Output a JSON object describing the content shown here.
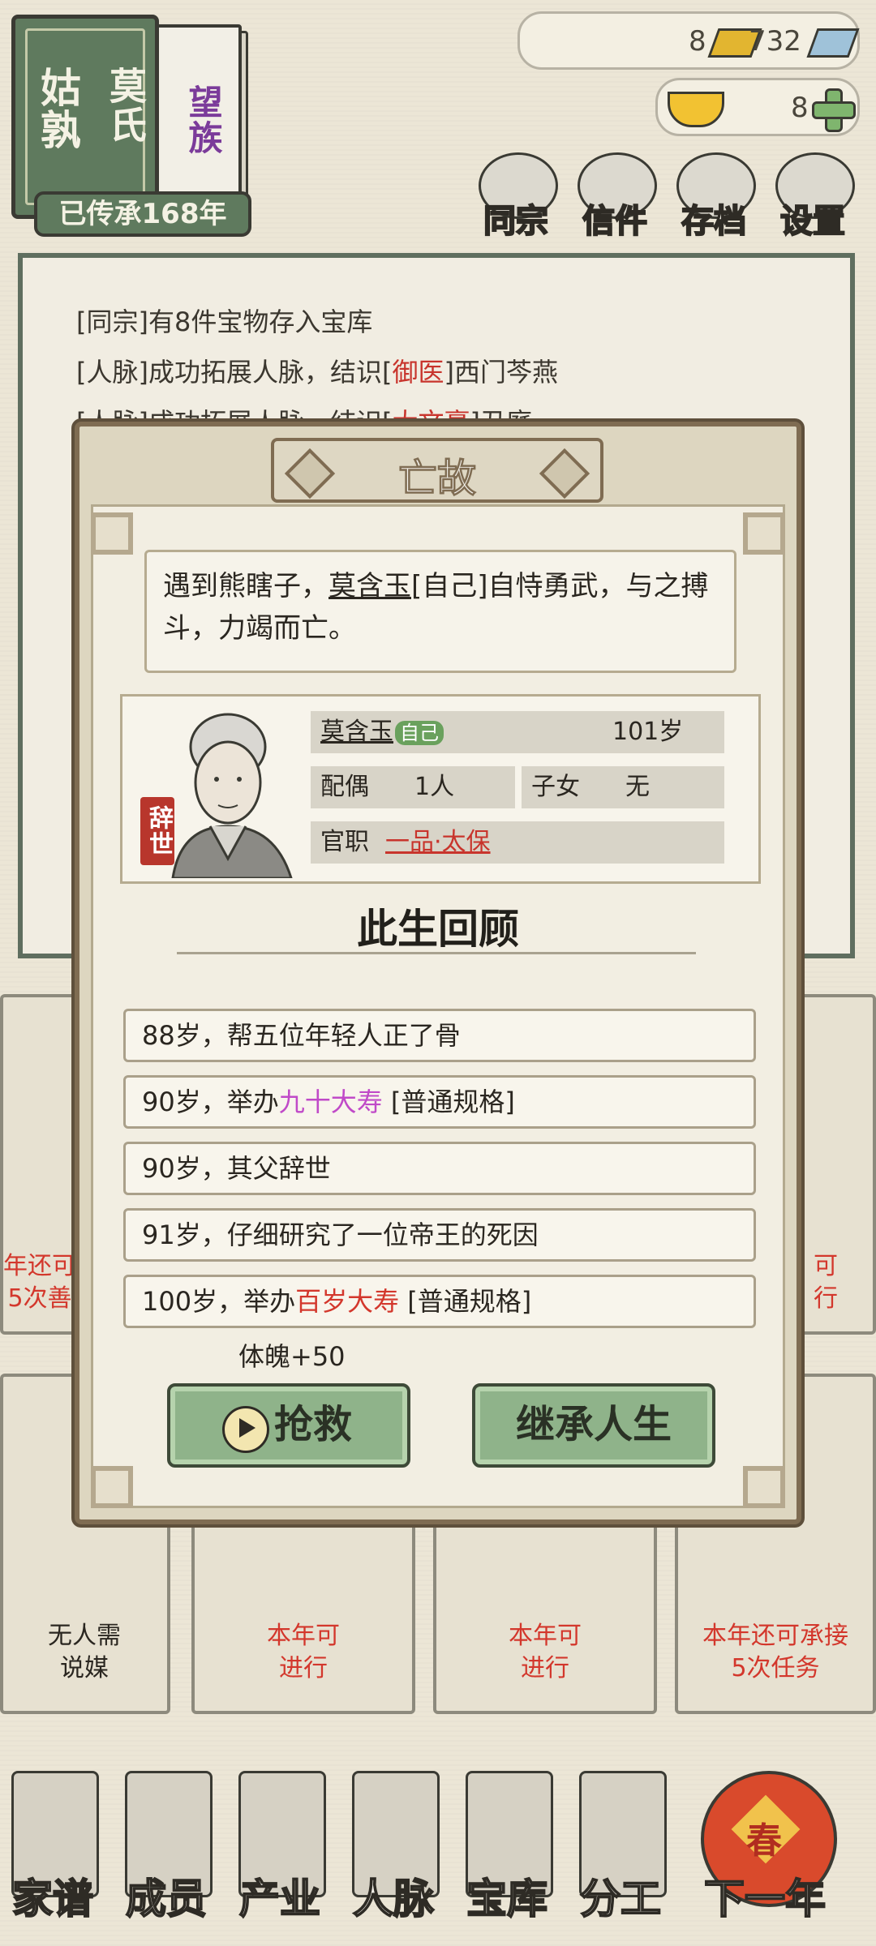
{
  "clan": {
    "surname": "姑孰",
    "name": "莫氏",
    "tag": "望族",
    "inherited": "已传承168年"
  },
  "currency": {
    "bars_count": "8",
    "silver_count": "732",
    "ingot_count": "8"
  },
  "top_menu": [
    "同宗",
    "信件",
    "存档",
    "设置"
  ],
  "log": [
    {
      "prefix": "[同宗]有8件宝物存入宝库",
      "red": "",
      "suffix": ""
    },
    {
      "prefix": "[人脉]成功拓展人脉，结识[",
      "red": "御医",
      "suffix": "]西门芩燕"
    },
    {
      "prefix": "[人脉]成功拓展人脉，结识[",
      "red": "大文豪",
      "suffix": "]丑庭"
    }
  ],
  "background": {
    "left_partial_1": "年还可",
    "left_partial_2": "5次善",
    "right_partial_1": "可",
    "right_partial_2": "行",
    "card1_line1": "无人需",
    "card1_line2": "说媒",
    "card2_line1": "本年可",
    "card2_line2": "进行",
    "card3_line1": "本年可",
    "card3_line2": "进行",
    "card4_line1": "本年还可承接",
    "card4_line2": "5次任务"
  },
  "modal": {
    "title": "亡故",
    "story_pre": "遇到熊瞎子，",
    "story_name": "莫含玉",
    "story_post": "[自己]自恃勇武，与之搏斗，力竭而亡。",
    "seal": "辞世",
    "person": {
      "name": "莫含玉",
      "self_badge": "自己",
      "age": "101岁",
      "spouse_label": "配偶",
      "spouse_value": "1人",
      "children_label": "子女",
      "children_value": "无",
      "office_label": "官职",
      "office_value": "一品·太保"
    },
    "review_title": "此生回顾",
    "entries": [
      {
        "pre": "88岁，帮五位年轻人正了骨",
        "hl": "",
        "post": "",
        "color": ""
      },
      {
        "pre": "90岁，举办",
        "hl": "九十大寿",
        "post": " [普通规格]",
        "color": "pink"
      },
      {
        "pre": "90岁，其父辞世",
        "hl": "",
        "post": "",
        "color": ""
      },
      {
        "pre": "91岁，仔细研究了一位帝王的死因",
        "hl": "",
        "post": "",
        "color": ""
      },
      {
        "pre": "100岁，举办",
        "hl": "百岁大寿",
        "post": " [普通规格]",
        "color": "red"
      }
    ],
    "bonus": "体魄+50",
    "rescue_button": "抢救",
    "inherit_button": "继承人生"
  },
  "bottom_nav": [
    "家谱",
    "成员",
    "产业",
    "人脉",
    "宝库",
    "分工",
    "下一年"
  ],
  "lantern_text": "春"
}
